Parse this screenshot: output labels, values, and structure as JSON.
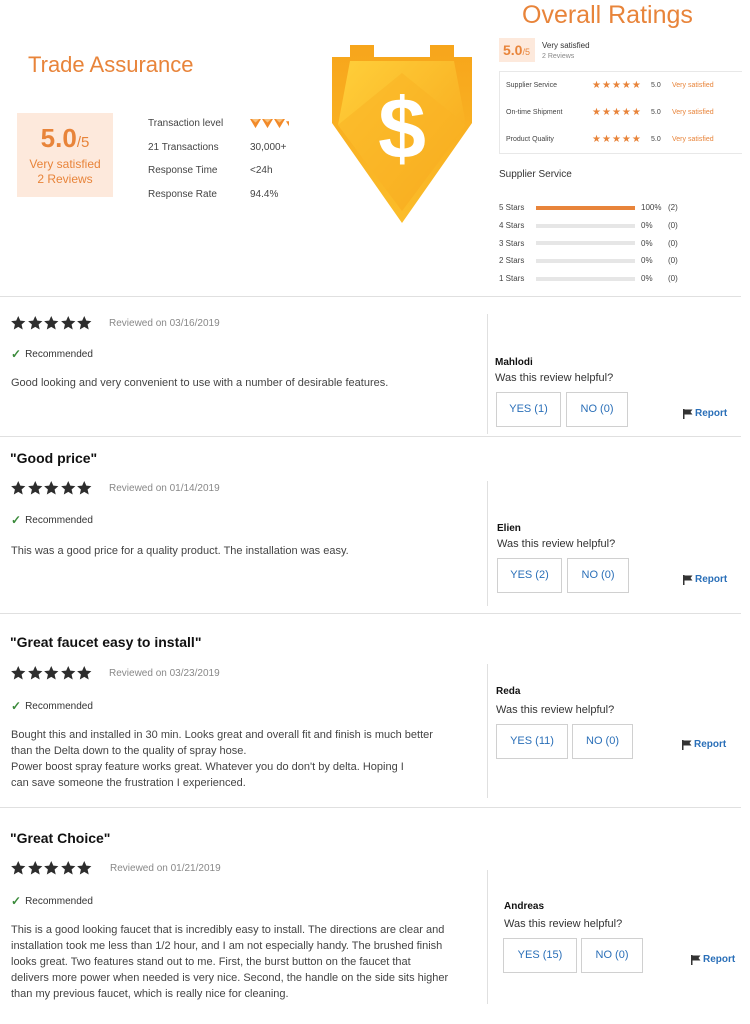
{
  "trade_assurance": {
    "title": "Trade Assurance",
    "score": "5.0",
    "score_den": "/5",
    "satisfaction": "Very satisfied",
    "reviews": "2 Reviews",
    "stats": [
      {
        "label": "Transaction level",
        "value": ""
      },
      {
        "label": "21 Transactions",
        "value": "30,000+"
      },
      {
        "label": "Response Time",
        "value": "<24h"
      },
      {
        "label": "Response Rate",
        "value": "94.4%"
      }
    ],
    "transaction_level_hearts": 3.5
  },
  "overall": {
    "title": "Overall Ratings",
    "score": "5.0",
    "score_den": "/5",
    "satisfaction": "Very satisfied",
    "reviews": "2 Reviews",
    "criteria": [
      {
        "name": "Supplier Service",
        "score": "5.0",
        "level": "Very satisfied"
      },
      {
        "name": "On-time Shipment",
        "score": "5.0",
        "level": "Very satisfied"
      },
      {
        "name": "Product Quality",
        "score": "5.0",
        "level": "Very satisfied"
      }
    ],
    "supplier_service_title": "Supplier Service",
    "distribution": [
      {
        "label": "5 Stars",
        "percent": "100%",
        "count": "(2)",
        "fill": 1.0
      },
      {
        "label": "4 Stars",
        "percent": "0%",
        "count": "(0)",
        "fill": 0
      },
      {
        "label": "3 Stars",
        "percent": "0%",
        "count": "(0)",
        "fill": 0
      },
      {
        "label": "2 Stars",
        "percent": "0%",
        "count": "(0)",
        "fill": 0
      },
      {
        "label": "1 Stars",
        "percent": "0%",
        "count": "(0)",
        "fill": 0
      }
    ]
  },
  "colors": {
    "accent": "#e8843a",
    "link": "#2a6fb8",
    "check": "#3a8a3a"
  },
  "reviews": [
    {
      "title": "",
      "date": "Reviewed on 03/16/2019",
      "rating": 5,
      "recommended": "Recommended",
      "text": "Good looking and very convenient to use with a number of desirable features.",
      "author": "Mahlodi",
      "helpful_q": "Was this review helpful?",
      "yes": "YES (1)",
      "no": "NO (0)",
      "report": "Report"
    },
    {
      "title": "\"Good price\"",
      "date": "Reviewed on 01/14/2019",
      "rating": 5,
      "recommended": "Recommended",
      "text": "This was a good price for a quality product. The installation was easy.",
      "author": "Elien",
      "helpful_q": "Was this review helpful?",
      "yes": "YES (2)",
      "no": "NO (0)",
      "report": "Report"
    },
    {
      "title": "\"Great faucet easy to install\"",
      "date": "Reviewed on 03/23/2019",
      "rating": 5,
      "recommended": "Recommended",
      "text": "Bought this and installed in 30 min. Looks  great and overall fit and finish is much better\n than the Delta down to the quality of spray hose.\n Power boost spray feature works great. Whatever you do don't by delta. Hoping I\ncan save someone the frustration I experienced.",
      "author": "Reda",
      "helpful_q": "Was this review helpful?",
      "yes": "YES (11)",
      "no": "NO (0)",
      "report": "Report"
    },
    {
      "title": "\"Great Choice\"",
      "date": "Reviewed on 01/21/2019",
      "rating": 5,
      "recommended": "Recommended",
      "text": "This is a good looking faucet that is incredibly easy to install. The directions are clear and\ninstallation took me less than 1/2 hour, and I am not especially handy. The brushed finish\nlooks great. Two features stand out to me. First, the burst button on the faucet that\ndelivers more power when needed is very nice. Second, the handle on the side sits higher\nthan my previous faucet, which is really nice for cleaning.",
      "author": "Andreas",
      "helpful_q": "Was this review helpful?",
      "yes": "YES (15)",
      "no": "NO (0)",
      "report": "Report"
    }
  ]
}
